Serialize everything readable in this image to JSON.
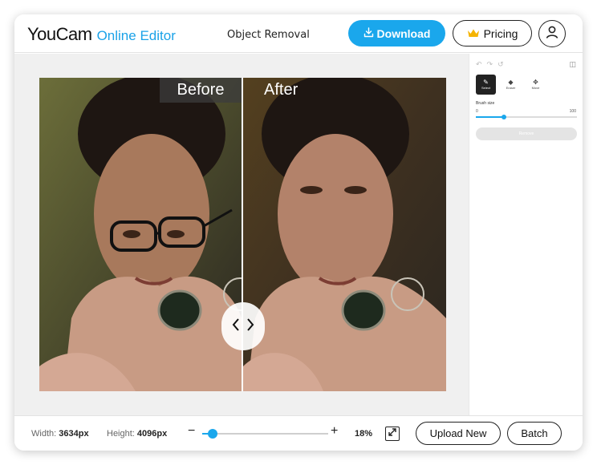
{
  "header": {
    "logo_main": "YouCam",
    "logo_sub": "Online Editor",
    "title": "Object Removal",
    "download_label": "Download",
    "pricing_label": "Pricing"
  },
  "compare": {
    "before_label": "Before",
    "after_label": "After"
  },
  "panel": {
    "tools": [
      {
        "label": "Select",
        "icon": "brush-icon",
        "active": true
      },
      {
        "label": "Eraser",
        "icon": "eraser-icon",
        "active": false
      },
      {
        "label": "Move",
        "icon": "move-icon",
        "active": false
      }
    ],
    "brush_size_label": "Brush size",
    "brush_min": "0",
    "brush_max": "100",
    "brush_value_fraction": 0.28,
    "remove_label": "Remove"
  },
  "footer": {
    "width_label": "Width:",
    "width_value": "3634px",
    "height_label": "Height:",
    "height_value": "4096px",
    "zoom_minus": "−",
    "zoom_plus": "+",
    "zoom_percent": "18%",
    "zoom_value_fraction": 0.08,
    "upload_label": "Upload New",
    "batch_label": "Batch"
  },
  "colors": {
    "accent": "#1aa7ec",
    "crown": "#f5b400"
  }
}
